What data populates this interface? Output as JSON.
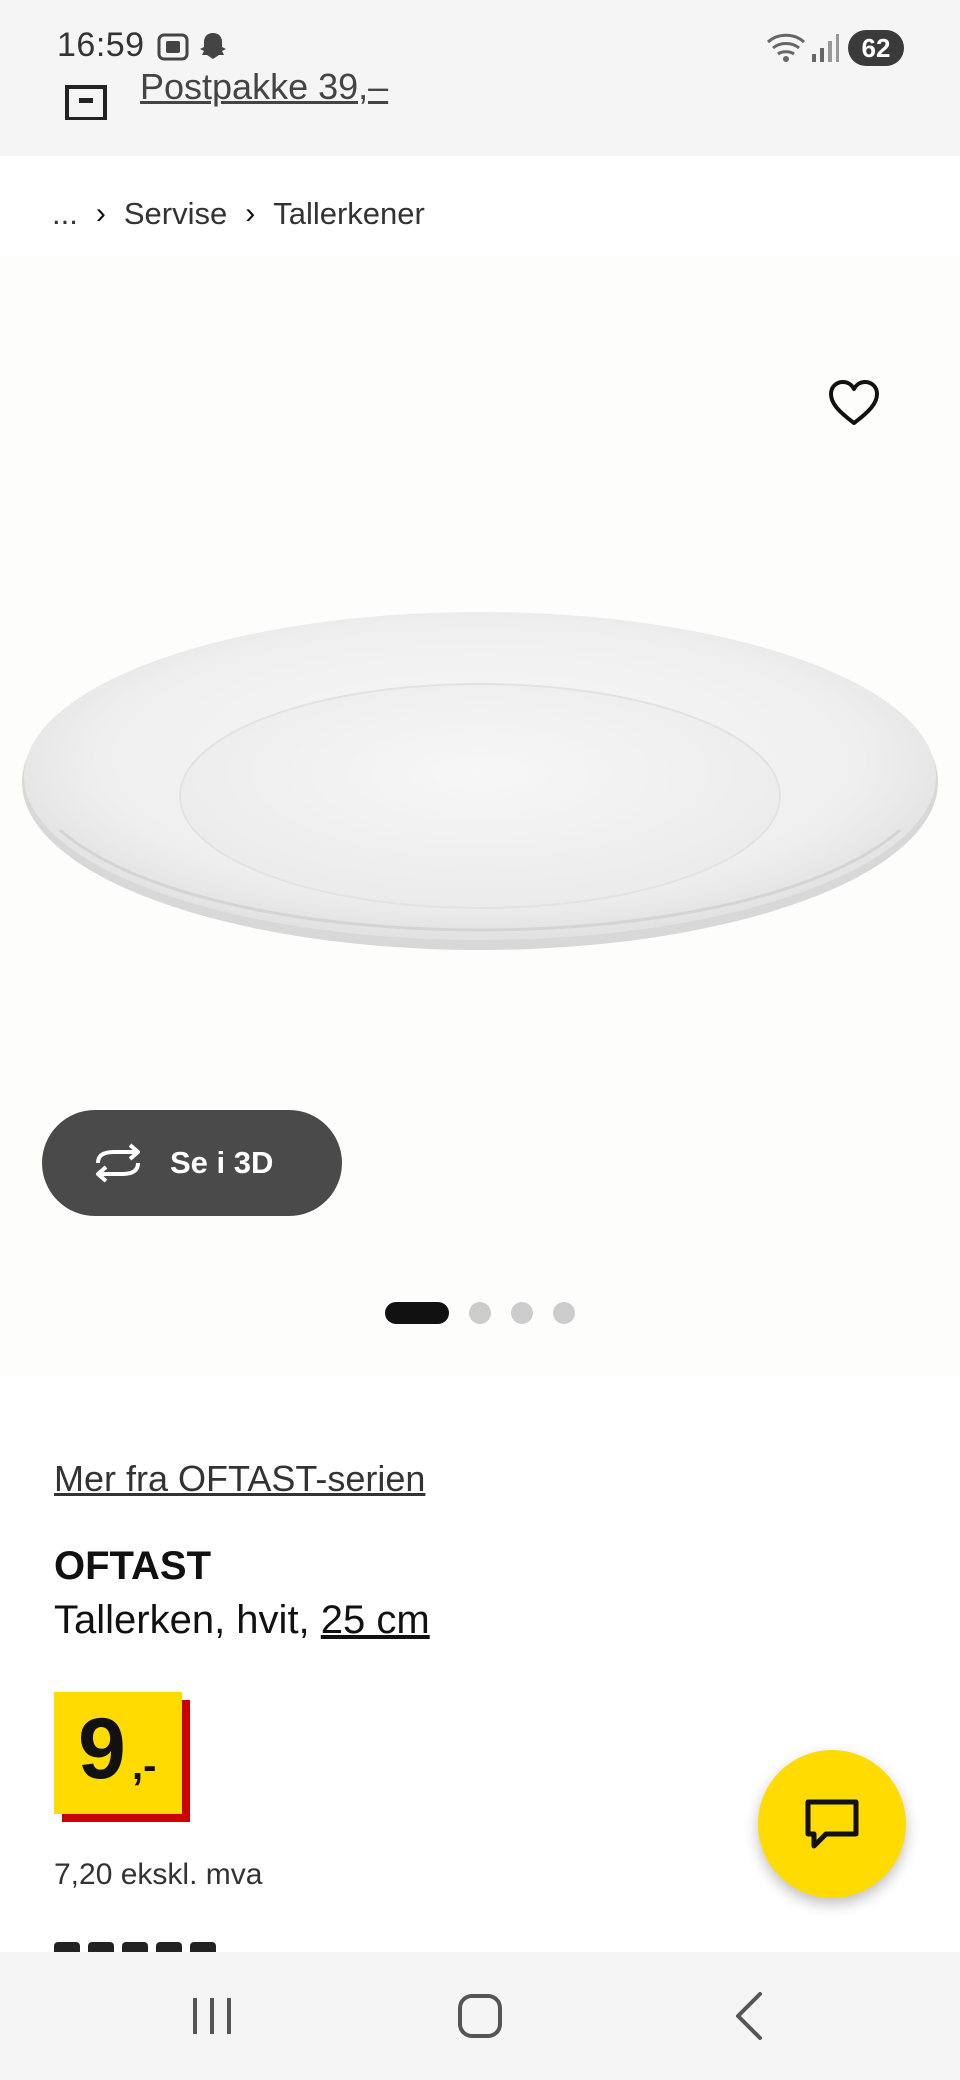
{
  "status_bar": {
    "time": "16:59",
    "battery": "62",
    "icons": [
      "screenshot-icon",
      "snapchat-icon",
      "wifi-icon",
      "signal-icon"
    ]
  },
  "promo": {
    "icon": "package-icon",
    "text": "Postpakke 39,–"
  },
  "breadcrumb": {
    "ellipsis": "...",
    "items": [
      "Servise",
      "Tallerkener"
    ]
  },
  "gallery": {
    "view_3d_label": "Se i 3D",
    "dot_count": 4,
    "active_dot": 0
  },
  "product": {
    "series_link": "Mer fra OFTAST-serien",
    "name": "OFTAST",
    "description": "Tallerken, hvit, ",
    "size": "25 cm",
    "price_main": "9",
    "price_suffix": ",-",
    "price_ex_vat": "7,20 ekskl. mva"
  },
  "colors": {
    "brand_yellow": "#ffdb00",
    "brand_red": "#cc0008",
    "dark_button": "#4a4a4a"
  },
  "nav_bar": {
    "icons": [
      "recent-apps-icon",
      "home-icon",
      "back-icon"
    ]
  }
}
